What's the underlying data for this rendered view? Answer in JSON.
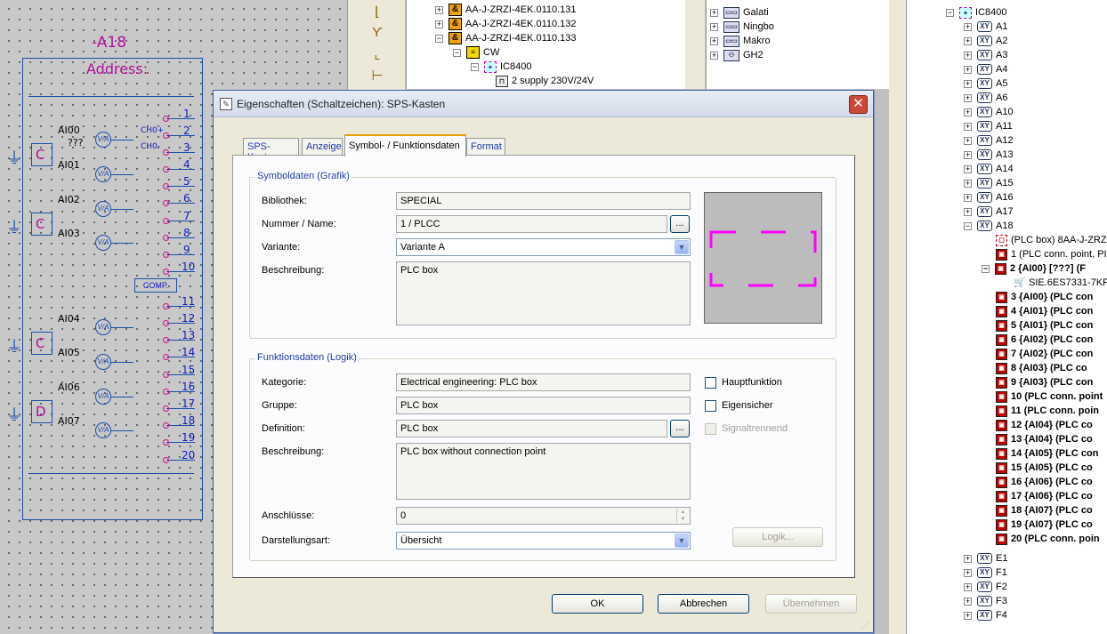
{
  "schematic": {
    "title": "-A18",
    "address_label": "Address:",
    "pins": [
      "1",
      "2",
      "3",
      "4",
      "5",
      "6",
      "7",
      "8",
      "9",
      "10",
      "11",
      "12",
      "13",
      "14",
      "15",
      "16",
      "17",
      "18",
      "19",
      "20"
    ],
    "channels": [
      {
        "name": "AI00",
        "sub": "???"
      },
      {
        "name": "AI01"
      },
      {
        "name": "AI02"
      },
      {
        "name": "AI03"
      },
      {
        "name": "AI04"
      },
      {
        "name": "AI05"
      },
      {
        "name": "AI06"
      },
      {
        "name": "AI07"
      }
    ],
    "ch_labels": [
      "CH0+",
      "CH0-"
    ],
    "va_label": "V/A",
    "comp_label": "COMP.",
    "boxes": [
      "C",
      "C",
      "C",
      "D"
    ]
  },
  "tree_mid": {
    "rows": [
      {
        "exp": "+",
        "icon": "amp",
        "label": "AA-J-ZRZI-4EK.0110.131"
      },
      {
        "exp": "+",
        "icon": "amp",
        "label": "AA-J-ZRZI-4EK.0110.132"
      },
      {
        "exp": "-",
        "icon": "amp",
        "label": "AA-J-ZRZI-4EK.0110.133"
      },
      {
        "exp": "-",
        "icon": "cw",
        "label": "CW"
      },
      {
        "exp": "-",
        "icon": "plc",
        "label": "IC8400"
      },
      {
        "exp": "",
        "icon": "sup",
        "label": "2 supply 230V/24V"
      }
    ]
  },
  "tree_loc": {
    "rows": [
      {
        "label": "Galati",
        "icon": "loc"
      },
      {
        "label": "Ningbo",
        "icon": "loc"
      },
      {
        "label": "Makro",
        "icon": "loc"
      },
      {
        "label": "GH2",
        "icon": "loc2"
      }
    ]
  },
  "tree_right": {
    "root": "IC8400",
    "xy_top": [
      "A1",
      "A2",
      "A3",
      "A4",
      "A5",
      "A6",
      "A10",
      "A11",
      "A12",
      "A13",
      "A14",
      "A15",
      "A16",
      "A17",
      "A18"
    ],
    "a18_children": [
      {
        "label": "(PLC box) 8AA-J-ZRZ",
        "icon": "box",
        "bold": false
      },
      {
        "label": "1 (PLC conn. point, PI",
        "icon": "pt",
        "bold": false
      },
      {
        "label": "2 {AI00} [???] (F",
        "icon": "pt",
        "bold": true,
        "expanded": true
      },
      {
        "label": "SIE.6ES7331-7KF",
        "icon": "cart",
        "bold": false,
        "sub": true
      },
      {
        "label": "3 {AI00} (PLC con",
        "icon": "pt",
        "bold": true
      },
      {
        "label": "4 {AI01} (PLC con",
        "icon": "pt",
        "bold": true
      },
      {
        "label": "5 {AI01} (PLC con",
        "icon": "pt",
        "bold": true
      },
      {
        "label": "6 {AI02} (PLC con",
        "icon": "pt",
        "bold": true
      },
      {
        "label": "7 {AI02} (PLC con",
        "icon": "pt",
        "bold": true
      },
      {
        "label": "8 {AI03} (PLC co",
        "icon": "pt",
        "bold": true
      },
      {
        "label": "9 {AI03} (PLC con",
        "icon": "pt",
        "bold": true
      },
      {
        "label": "10 (PLC conn. point",
        "icon": "pt",
        "bold": true
      },
      {
        "label": "11 (PLC conn. poin",
        "icon": "pt",
        "bold": true
      },
      {
        "label": "12 {AI04} (PLC co",
        "icon": "pt",
        "bold": true
      },
      {
        "label": "13 {AI04} (PLC co",
        "icon": "pt",
        "bold": true
      },
      {
        "label": "14 {AI05} (PLC con",
        "icon": "pt",
        "bold": true
      },
      {
        "label": "15 {AI05} (PLC co",
        "icon": "pt",
        "bold": true
      },
      {
        "label": "16 {AI06} (PLC co",
        "icon": "pt",
        "bold": true
      },
      {
        "label": "17 {AI06} (PLC co",
        "icon": "pt",
        "bold": true
      },
      {
        "label": "18 {AI07} (PLC co",
        "icon": "pt",
        "bold": true
      },
      {
        "label": "19 {AI07} (PLC co",
        "icon": "pt",
        "bold": true
      },
      {
        "label": "20 (PLC conn. poin",
        "icon": "pt",
        "bold": true
      }
    ],
    "xy_bottom": [
      "E1",
      "F1",
      "F2",
      "F3",
      "F4"
    ]
  },
  "dialog": {
    "title": "Eigenschaften (Schaltzeichen): SPS-Kasten",
    "tabs": [
      "SPS-Kasten",
      "Anzeige",
      "Symbol- / Funktionsdaten",
      "Format"
    ],
    "active_tab": 2,
    "symbol_group": {
      "title": "Symboldaten (Grafik)",
      "library_label": "Bibliothek:",
      "library_value": "SPECIAL",
      "number_label": "Nummer / Name:",
      "number_value": "1 / PLCC",
      "variant_label": "Variante:",
      "variant_value": "Variante A",
      "desc_label": "Beschreibung:",
      "desc_value": "PLC box"
    },
    "function_group": {
      "title": "Funktionsdaten (Logik)",
      "category_label": "Kategorie:",
      "category_value": "Electrical engineering: PLC box",
      "group_label": "Gruppe:",
      "group_value": "PLC box",
      "definition_label": "Definition:",
      "definition_value": "PLC box",
      "desc_label": "Beschreibung:",
      "desc_value": "PLC box without connection point",
      "connections_label": "Anschlüsse:",
      "connections_value": "0",
      "display_label": "Darstellungsart:",
      "display_value": "Übersicht",
      "main_function": "Hauptfunktion",
      "intrinsic_safe": "Eigensicher",
      "signal_isolating": "Signaltrennend",
      "logic_button": "Logik..."
    },
    "dots": "...",
    "ok": "OK",
    "cancel": "Abbrechen",
    "apply": "Übernehmen",
    "colors": {
      "accent": "#1f3ca8",
      "preview_dash": "#ff00ff"
    }
  }
}
